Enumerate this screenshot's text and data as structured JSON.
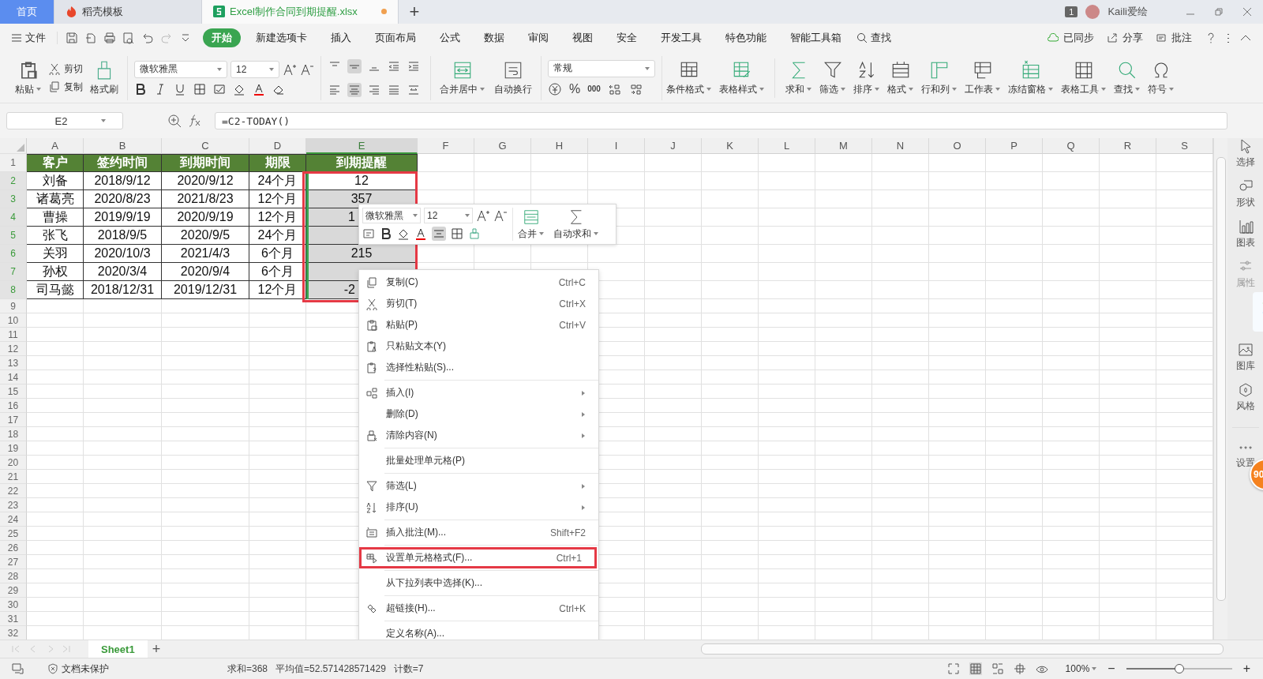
{
  "tabs": [
    {
      "label": "首页",
      "kind": "home",
      "selected": false
    },
    {
      "label": "稻壳模板",
      "kind": "docer",
      "selected": false
    },
    {
      "label": "Excel制作合同到期提醒.xlsx",
      "kind": "sheet",
      "selected": true,
      "unsaved": true
    }
  ],
  "new_tab": "+",
  "window_count": "1",
  "user": "Kaili爱绘",
  "menu": {
    "file": "文件",
    "tabs": [
      {
        "label": "开始",
        "selected": true
      },
      {
        "label": "新建选项卡",
        "selected": false
      },
      {
        "label": "插入",
        "selected": false
      },
      {
        "label": "页面布局",
        "selected": false
      },
      {
        "label": "公式",
        "selected": false
      },
      {
        "label": "数据",
        "selected": false
      },
      {
        "label": "审阅",
        "selected": false
      },
      {
        "label": "视图",
        "selected": false
      },
      {
        "label": "安全",
        "selected": false
      },
      {
        "label": "开发工具",
        "selected": false
      },
      {
        "label": "特色功能",
        "selected": false
      },
      {
        "label": "智能工具箱",
        "selected": false
      }
    ],
    "search": "查找",
    "actions": [
      "已同步",
      "分享",
      "批注"
    ]
  },
  "ribbon": {
    "paste": "粘贴",
    "cut": "剪切",
    "copy": "复制",
    "format_painter": "格式刷",
    "font": "微软雅黑",
    "size": "12",
    "merge": "合并居中",
    "wrap": "自动换行",
    "number_format": "常规",
    "percent": "%",
    "thousands": "000",
    "tools": [
      "条件格式",
      "表格样式",
      "求和",
      "筛选",
      "排序",
      "格式",
      "行和列",
      "工作表",
      "冻结窗格",
      "表格工具",
      "查找",
      "符号"
    ]
  },
  "formula_bar": {
    "name_box": "E2",
    "formula": "=C2-TODAY()"
  },
  "sheet": {
    "columns": [
      {
        "label": "A",
        "selected": false
      },
      {
        "label": "B",
        "selected": false
      },
      {
        "label": "C",
        "selected": false
      },
      {
        "label": "D",
        "selected": false
      },
      {
        "label": "E",
        "selected": true
      },
      {
        "label": "F",
        "selected": false
      },
      {
        "label": "G",
        "selected": false
      },
      {
        "label": "H",
        "selected": false
      },
      {
        "label": "I",
        "selected": false
      },
      {
        "label": "J",
        "selected": false
      },
      {
        "label": "K",
        "selected": false
      },
      {
        "label": "L",
        "selected": false
      },
      {
        "label": "M",
        "selected": false
      },
      {
        "label": "N",
        "selected": false
      },
      {
        "label": "O",
        "selected": false
      },
      {
        "label": "P",
        "selected": false
      },
      {
        "label": "Q",
        "selected": false
      },
      {
        "label": "R",
        "selected": false
      },
      {
        "label": "S",
        "selected": false
      }
    ],
    "header": {
      "number": "1",
      "cells": [
        "客户",
        "签约时间",
        "到期时间",
        "期限",
        "到期提醒"
      ]
    },
    "rows": [
      {
        "number": "2",
        "in_selection": true,
        "cells": [
          "刘备",
          "2018/9/12",
          "2020/9/12",
          "24个月"
        ],
        "reminder": "12",
        "shaded": false,
        "cut": false
      },
      {
        "number": "3",
        "in_selection": true,
        "cells": [
          "诸葛亮",
          "2020/8/23",
          "2021/8/23",
          "12个月"
        ],
        "reminder": "357",
        "shaded": true,
        "cut": false
      },
      {
        "number": "4",
        "in_selection": true,
        "cells": [
          "曹操",
          "2019/9/19",
          "2020/9/19",
          "12个月"
        ],
        "reminder": "1",
        "shaded": true,
        "cut": true
      },
      {
        "number": "5",
        "in_selection": true,
        "cells": [
          "张飞",
          "2018/9/5",
          "2020/9/5",
          "24个月"
        ],
        "shaded": true
      },
      {
        "number": "6",
        "in_selection": true,
        "cells": [
          "关羽",
          "2020/10/3",
          "2021/4/3",
          "6个月"
        ],
        "reminder": "215",
        "shaded": true,
        "cut": false
      },
      {
        "number": "7",
        "in_selection": true,
        "cells": [
          "孙权",
          "2020/3/4",
          "2020/9/4",
          "6个月"
        ],
        "shaded": true
      },
      {
        "number": "8",
        "in_selection": true,
        "cells": [
          "司马懿",
          "2018/12/31",
          "2019/12/31",
          "12个月"
        ],
        "reminder": "-2",
        "shaded": true,
        "cut": true
      }
    ],
    "empty_rows": [
      "9",
      "10",
      "11",
      "12",
      "13",
      "14",
      "15",
      "16",
      "17",
      "18",
      "19",
      "20",
      "21",
      "22",
      "23",
      "24",
      "25",
      "26",
      "27",
      "28",
      "29",
      "30",
      "31",
      "32"
    ]
  },
  "mini_toolbar": {
    "font": "微软雅黑",
    "size": "12",
    "buttons": [
      "合并",
      "自动求和"
    ]
  },
  "context_menu": [
    [
      {
        "label": "复制(C)",
        "shortcut": "Ctrl+C",
        "submenu": false,
        "highlighted": false
      },
      {
        "label": "剪切(T)",
        "shortcut": "Ctrl+X",
        "submenu": false,
        "highlighted": false
      },
      {
        "label": "粘贴(P)",
        "shortcut": "Ctrl+V",
        "submenu": false,
        "highlighted": false
      },
      {
        "label": "只粘贴文本(Y)",
        "submenu": false,
        "highlighted": false
      },
      {
        "label": "选择性粘贴(S)...",
        "submenu": false,
        "highlighted": false
      }
    ],
    [
      {
        "label": "插入(I)",
        "submenu": true,
        "highlighted": false
      },
      {
        "label": "删除(D)",
        "submenu": true,
        "highlighted": false
      },
      {
        "label": "清除内容(N)",
        "submenu": true,
        "highlighted": false
      }
    ],
    [
      {
        "label": "批量处理单元格(P)",
        "submenu": false,
        "highlighted": false
      }
    ],
    [
      {
        "label": "筛选(L)",
        "submenu": true,
        "highlighted": false
      },
      {
        "label": "排序(U)",
        "submenu": true,
        "highlighted": false
      }
    ],
    [
      {
        "label": "插入批注(M)...",
        "shortcut": "Shift+F2",
        "submenu": false,
        "highlighted": false
      }
    ],
    [
      {
        "label": "设置单元格格式(F)...",
        "shortcut": "Ctrl+1",
        "submenu": false,
        "highlighted": true
      }
    ],
    [
      {
        "label": "从下拉列表中选择(K)...",
        "submenu": false,
        "highlighted": false
      }
    ],
    [
      {
        "label": "超链接(H)...",
        "shortcut": "Ctrl+K",
        "submenu": false,
        "highlighted": false
      }
    ],
    [
      {
        "label": "定义名称(A)...",
        "submenu": false,
        "highlighted": false
      }
    ]
  ],
  "sidebar": [
    {
      "label": "选择",
      "disabled": false
    },
    {
      "label": "形状",
      "disabled": false
    },
    {
      "label": "图表",
      "disabled": false
    },
    {
      "label": "属性",
      "disabled": true
    },
    {
      "label": "图库",
      "disabled": false
    },
    {
      "label": "风格",
      "disabled": false
    },
    {
      "label": "设置",
      "disabled": false
    }
  ],
  "badge": "90",
  "sheet_tabs": [
    {
      "label": "Sheet1",
      "selected": true
    }
  ],
  "add_sheet": "+",
  "status_bar": {
    "protection": "文档未保护",
    "sum": "求和=368",
    "average": "平均值=52.571428571429",
    "count": "计数=7",
    "zoom": "100%",
    "zoom_out": "−",
    "zoom_in": "+",
    "level": 0.5
  }
}
